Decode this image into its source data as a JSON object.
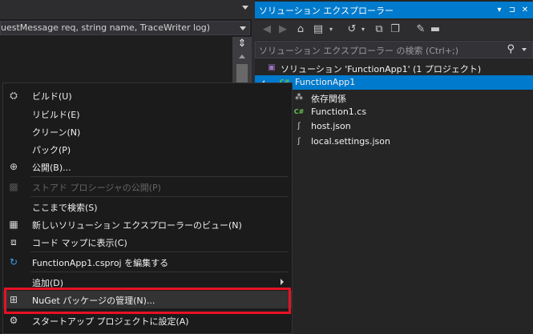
{
  "editor": {
    "member_bar_text": "uestMessage req, string name, TraceWriter log)"
  },
  "explorer": {
    "title": "ソリューション エクスプローラー",
    "title_buttons": [
      "▾",
      "⊐",
      "✕"
    ],
    "search_placeholder": "ソリューション エクスプローラー の検索 (Ctrl+;)",
    "toolbar_icons": [
      "back-icon",
      "forward-icon",
      "home-icon",
      "switch-views-icon",
      "history-icon",
      "collapse-all-icon",
      "show-all-files-icon",
      "properties-icon",
      "preview-icon"
    ],
    "tree": [
      {
        "label": "ソリューション 'FunctionApp1' (1 プロジェクト)",
        "icon": "solution-icon",
        "selected": false
      },
      {
        "label": "FunctionApp1",
        "icon": "csharp-project-icon",
        "selected": true
      },
      {
        "label": "依存関係",
        "icon": "dependencies-icon",
        "selected": false
      },
      {
        "label": "Function1.cs",
        "icon": "csharp-file-icon",
        "selected": false
      },
      {
        "label": "host.json",
        "icon": "json-file-icon",
        "selected": false
      },
      {
        "label": "local.settings.json",
        "icon": "json-file-icon",
        "selected": false
      }
    ]
  },
  "context_menu": {
    "items": [
      {
        "label": "ビルド(U)",
        "icon": "build-icon",
        "disabled": false
      },
      {
        "label": "リビルド(E)",
        "icon": "",
        "disabled": false
      },
      {
        "label": "クリーン(N)",
        "icon": "",
        "disabled": false
      },
      {
        "label": "パック(P)",
        "icon": "",
        "disabled": false
      },
      {
        "label": "公開(B)...",
        "icon": "publish-icon",
        "disabled": false
      },
      {
        "label": "ストアド プロシージャの公開(P)",
        "icon": "store-publish-icon",
        "disabled": true
      },
      {
        "label": "ここまで検索(S)",
        "icon": "",
        "disabled": false
      },
      {
        "label": "新しいソリューション エクスプローラーのビュー(N)",
        "icon": "new-view-icon",
        "disabled": false
      },
      {
        "label": "コード マップに表示(C)",
        "icon": "code-map-icon",
        "disabled": false
      },
      {
        "label": "FunctionApp1.csproj を編集する",
        "icon": "edit-project-icon",
        "disabled": false
      },
      {
        "label": "追加(D)",
        "icon": "",
        "disabled": false,
        "submenu": true
      },
      {
        "label": "NuGet パッケージの管理(N)...",
        "icon": "nuget-icon",
        "disabled": false,
        "highlighted": true
      },
      {
        "label": "スタートアップ プロジェクトに設定(A)",
        "icon": "settings-gear-icon",
        "disabled": false
      }
    ]
  },
  "colors": {
    "accent": "#007acc",
    "highlight_outline": "#e81123",
    "menu_bg": "#1b1b1c"
  }
}
